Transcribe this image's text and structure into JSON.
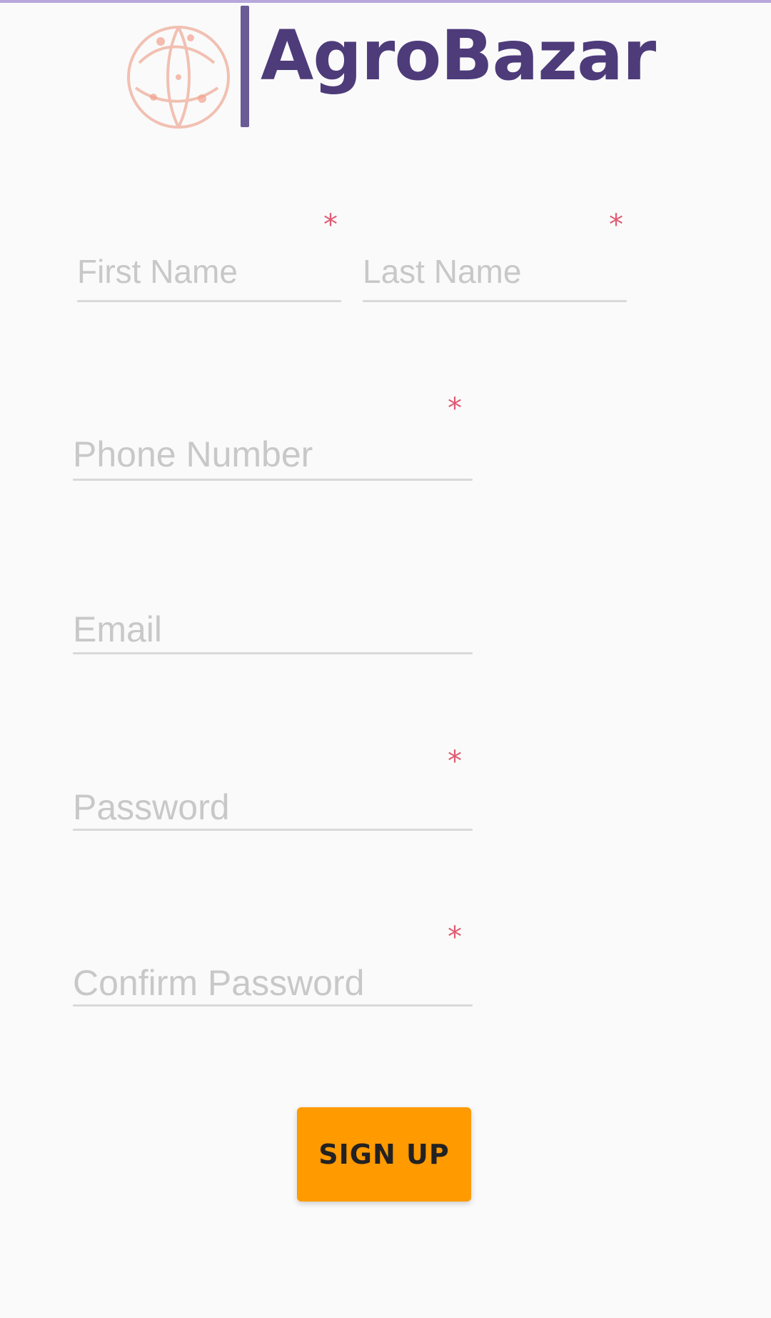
{
  "app": {
    "brand_name": "AgroBazar",
    "colors": {
      "brand_purple": "#4e3b7a",
      "accent_orange": "#ff9a00",
      "required_marker": "#e05b72",
      "placeholder": "#c8c8c8",
      "underline": "#d9d9d9"
    }
  },
  "form": {
    "first_name": {
      "placeholder": "First Name",
      "value": "",
      "required": true,
      "required_marker": "*"
    },
    "last_name": {
      "placeholder": "Last Name",
      "value": "",
      "required": true,
      "required_marker": "*"
    },
    "phone": {
      "placeholder": "Phone Number",
      "value": "",
      "required": true,
      "required_marker": "*"
    },
    "email": {
      "placeholder": "Email",
      "value": "",
      "required": false
    },
    "password": {
      "placeholder": "Password",
      "value": "",
      "required": true,
      "required_marker": "*"
    },
    "confirm_password": {
      "placeholder": "Confirm Password",
      "value": "",
      "required": true,
      "required_marker": "*"
    }
  },
  "actions": {
    "signup_label": "SIGN UP"
  },
  "icons": {
    "logo": "globe-logo-icon",
    "required": "required-asterisk-icon"
  }
}
